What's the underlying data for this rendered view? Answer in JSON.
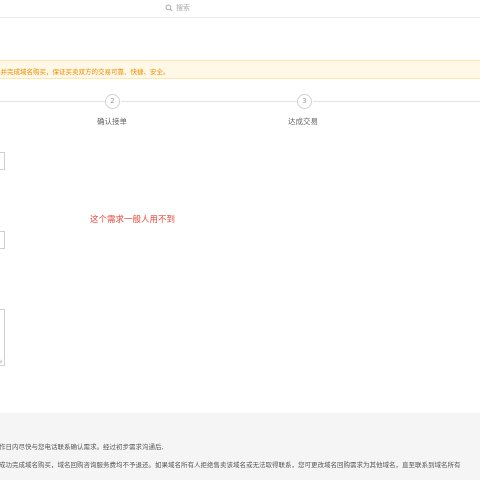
{
  "header": {
    "search_placeholder": "搜索"
  },
  "notice": {
    "text": "们并完成域名购买，保证买卖双方的交易可靠、快捷、安全。"
  },
  "steps": [
    {
      "number": "2",
      "label": "确认接单"
    },
    {
      "number": "3",
      "label": "达成交易"
    }
  ],
  "annotation": "这个需求一般人用不到",
  "footer": {
    "line1": "作日内尽快与您电话联系确认需求。经过初步需求沟通后,",
    "line2": "成功完成域名购买，域名回购咨询服务费均不予退还。如果域名所有人拒绝售卖该域名或无法取得联系，您可更改域名回购需求为其他域名，直至联系到域名所有"
  },
  "colors": {
    "notice_background": "#fff8e6",
    "notice_text": "#f08a00",
    "annotation": "#e8473a",
    "footer_background": "#f5f5f5"
  }
}
